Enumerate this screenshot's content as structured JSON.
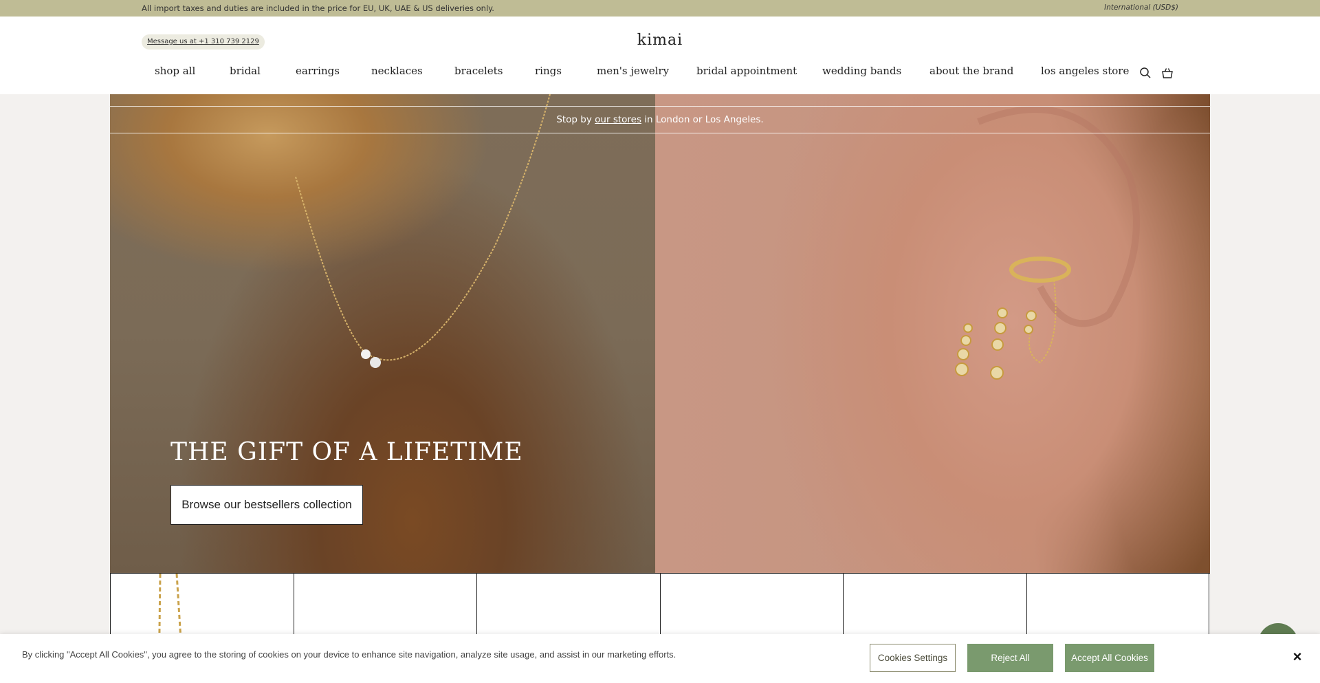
{
  "announcement": {
    "text": "All import taxes and duties are included in the price for EU, UK, UAE & US deliveries only.",
    "currency": "International (USD$)"
  },
  "header": {
    "message_link": "Message us at +1 310 739 2129",
    "logo": "kimai",
    "nav": [
      {
        "label": "shop all"
      },
      {
        "label": "bridal"
      },
      {
        "label": "earrings"
      },
      {
        "label": "necklaces"
      },
      {
        "label": "bracelets"
      },
      {
        "label": "rings"
      },
      {
        "label": "men's jewelry"
      },
      {
        "label": "bridal appointment"
      },
      {
        "label": "wedding bands"
      },
      {
        "label": "about the brand"
      },
      {
        "label": "los angeles store"
      }
    ],
    "icons": [
      "search-icon",
      "cart-icon"
    ]
  },
  "hero": {
    "strip_prefix": "Stop by ",
    "strip_link": "our stores",
    "strip_suffix": " in London or Los Angeles.",
    "title": "THE GIFT OF A LIFETIME",
    "cta": "Browse our bestsellers collection"
  },
  "cookie": {
    "text": "By clicking \"Accept All Cookies\", you agree to the storing of cookies on your device to enhance site navigation, analyze site usage, and assist in our marketing efforts.",
    "settings": "Cookies Settings",
    "reject": "Reject All",
    "accept": "Accept All Cookies",
    "close": "×"
  },
  "colors": {
    "announcement_bg": "#bfbc95",
    "button_green": "#7a9a6e",
    "chat_green": "#5f7c52"
  }
}
